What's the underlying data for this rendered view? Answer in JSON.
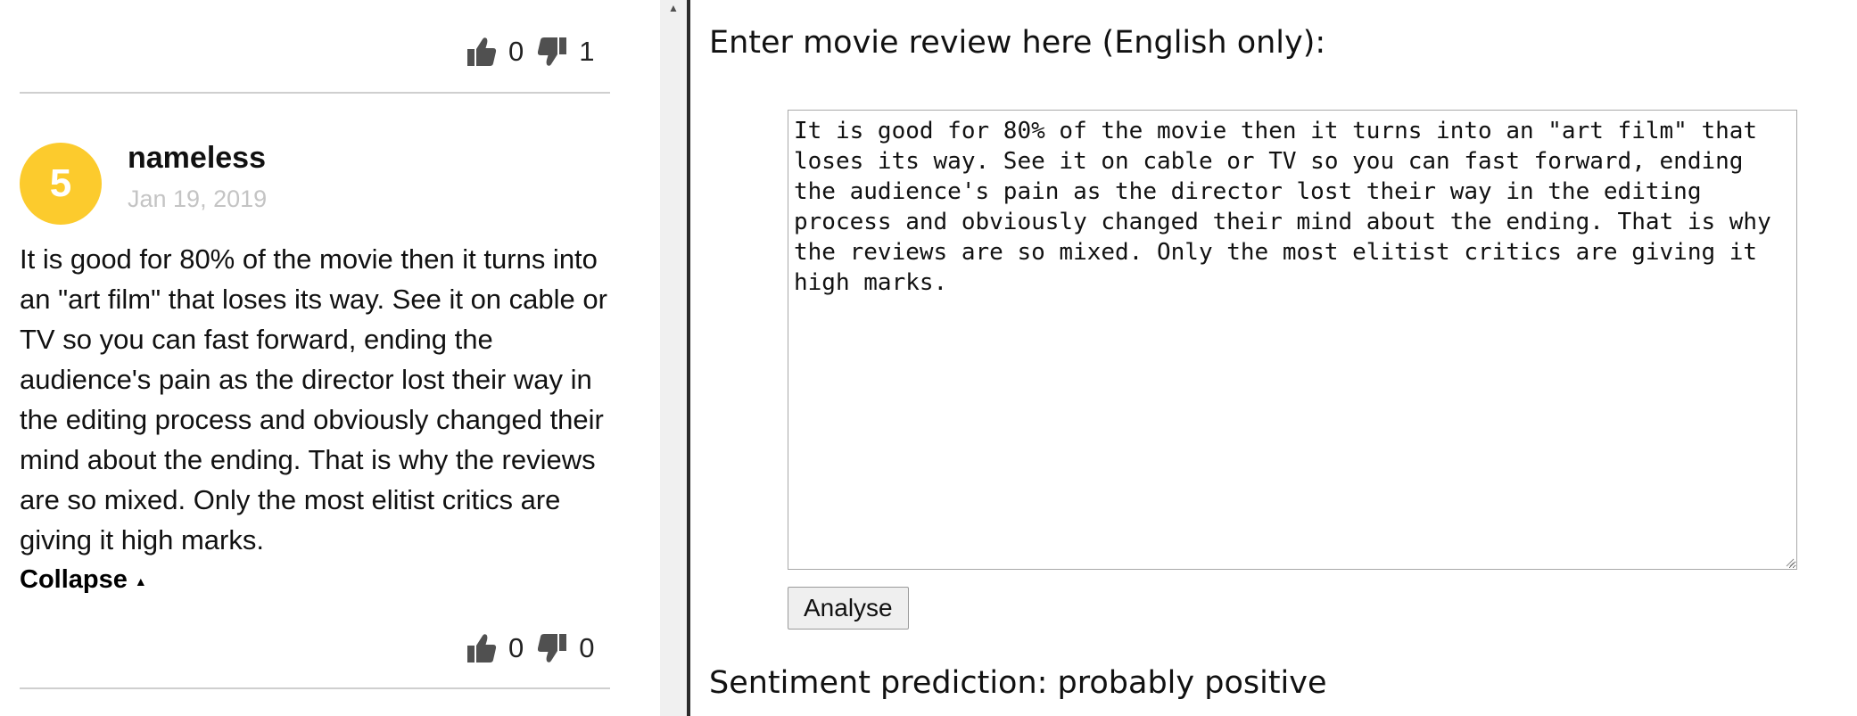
{
  "reviews": {
    "previous": {
      "upvotes": "0",
      "downvotes": "1"
    },
    "current": {
      "rating": "5",
      "username": "nameless",
      "date": "Jan 19, 2019",
      "text": "It is good for 80% of the movie then it turns into an \"art film\" that loses its way. See it on cable or TV so you can fast forward, ending the audience's pain as the director lost their way in the editing process and obviously changed their mind about the ending. That is why the reviews are so mixed. Only the most elitist critics are giving it high marks.",
      "collapse_label": "Collapse",
      "upvotes": "0",
      "downvotes": "0"
    }
  },
  "analyzer": {
    "prompt_label": "Enter movie review here (English only):",
    "review_input_value": "It is good for 80% of the movie then it turns into an \"art film\" that loses its way. See it on cable or TV so you can fast forward, ending the audience's pain as the director lost their way in the editing process and obviously changed their mind about the ending. That is why the reviews are so mixed. Only the most elitist critics are giving it high marks.",
    "analyse_button_label": "Analyse",
    "prediction_text": "Sentiment prediction: probably positive"
  },
  "icons": {
    "upvote": "thumbs-up-icon",
    "downvote": "thumbs-down-icon",
    "collapse": "caret-up-icon",
    "scroll": "scroll-up-arrow-icon"
  },
  "colors": {
    "avatar_bg": "#fccb2d",
    "date_text": "#c4c4c4",
    "divider": "#2b2b2b",
    "rule": "#cfcfcf"
  }
}
